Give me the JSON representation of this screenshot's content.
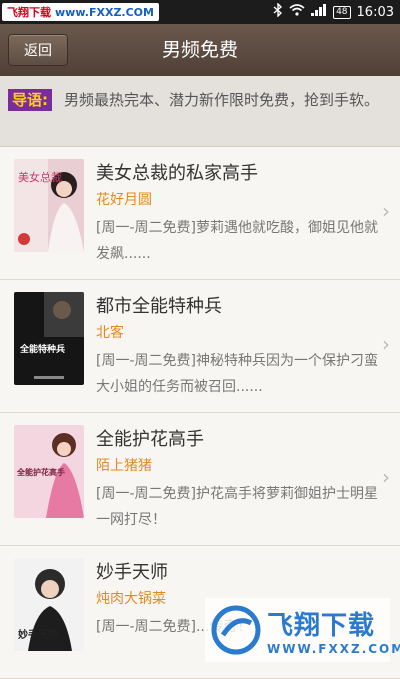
{
  "status_bar": {
    "watermark_cn": "飞翔下载",
    "watermark_url": "www.FXXZ.COM",
    "battery": "48",
    "time": "16:03"
  },
  "nav": {
    "back_label": "返回",
    "title": "男频免费"
  },
  "intro": {
    "tag": "导语:",
    "text": "男频最热完本、潜力新作限时免费，抢到手软。"
  },
  "books": [
    {
      "title": "美女总裁的私家高手",
      "author": "花好月圆",
      "desc": "[周一-周二免费]萝莉遇他就吃酸，御姐见他就发飙......",
      "cover_text": "美女总裁"
    },
    {
      "title": "都市全能特种兵",
      "author": "北客",
      "desc": "[周一-周二免费]神秘特种兵因为一个保护刁蛮大小姐的任务而被召回......",
      "cover_text": "全能特种兵"
    },
    {
      "title": "全能护花高手",
      "author": "陌上猪猪",
      "desc": "[周一-周二免费]护花高手将萝莉御姐护士明星一网打尽！",
      "cover_text": "全能护花高手"
    },
    {
      "title": "妙手天师",
      "author": "炖肉大锅菜",
      "desc": "[周一-周二免费]...传奇！",
      "cover_text": "妙手天师"
    }
  ],
  "watermark_bottom": {
    "cn": "飞翔下载",
    "en": "WWW.FXXZ.COM"
  },
  "colors": {
    "nav_bg": "#5a4a40",
    "author": "#e58a1f",
    "tag_bg": "#7a2b9e",
    "tag_text": "#ffd400"
  }
}
